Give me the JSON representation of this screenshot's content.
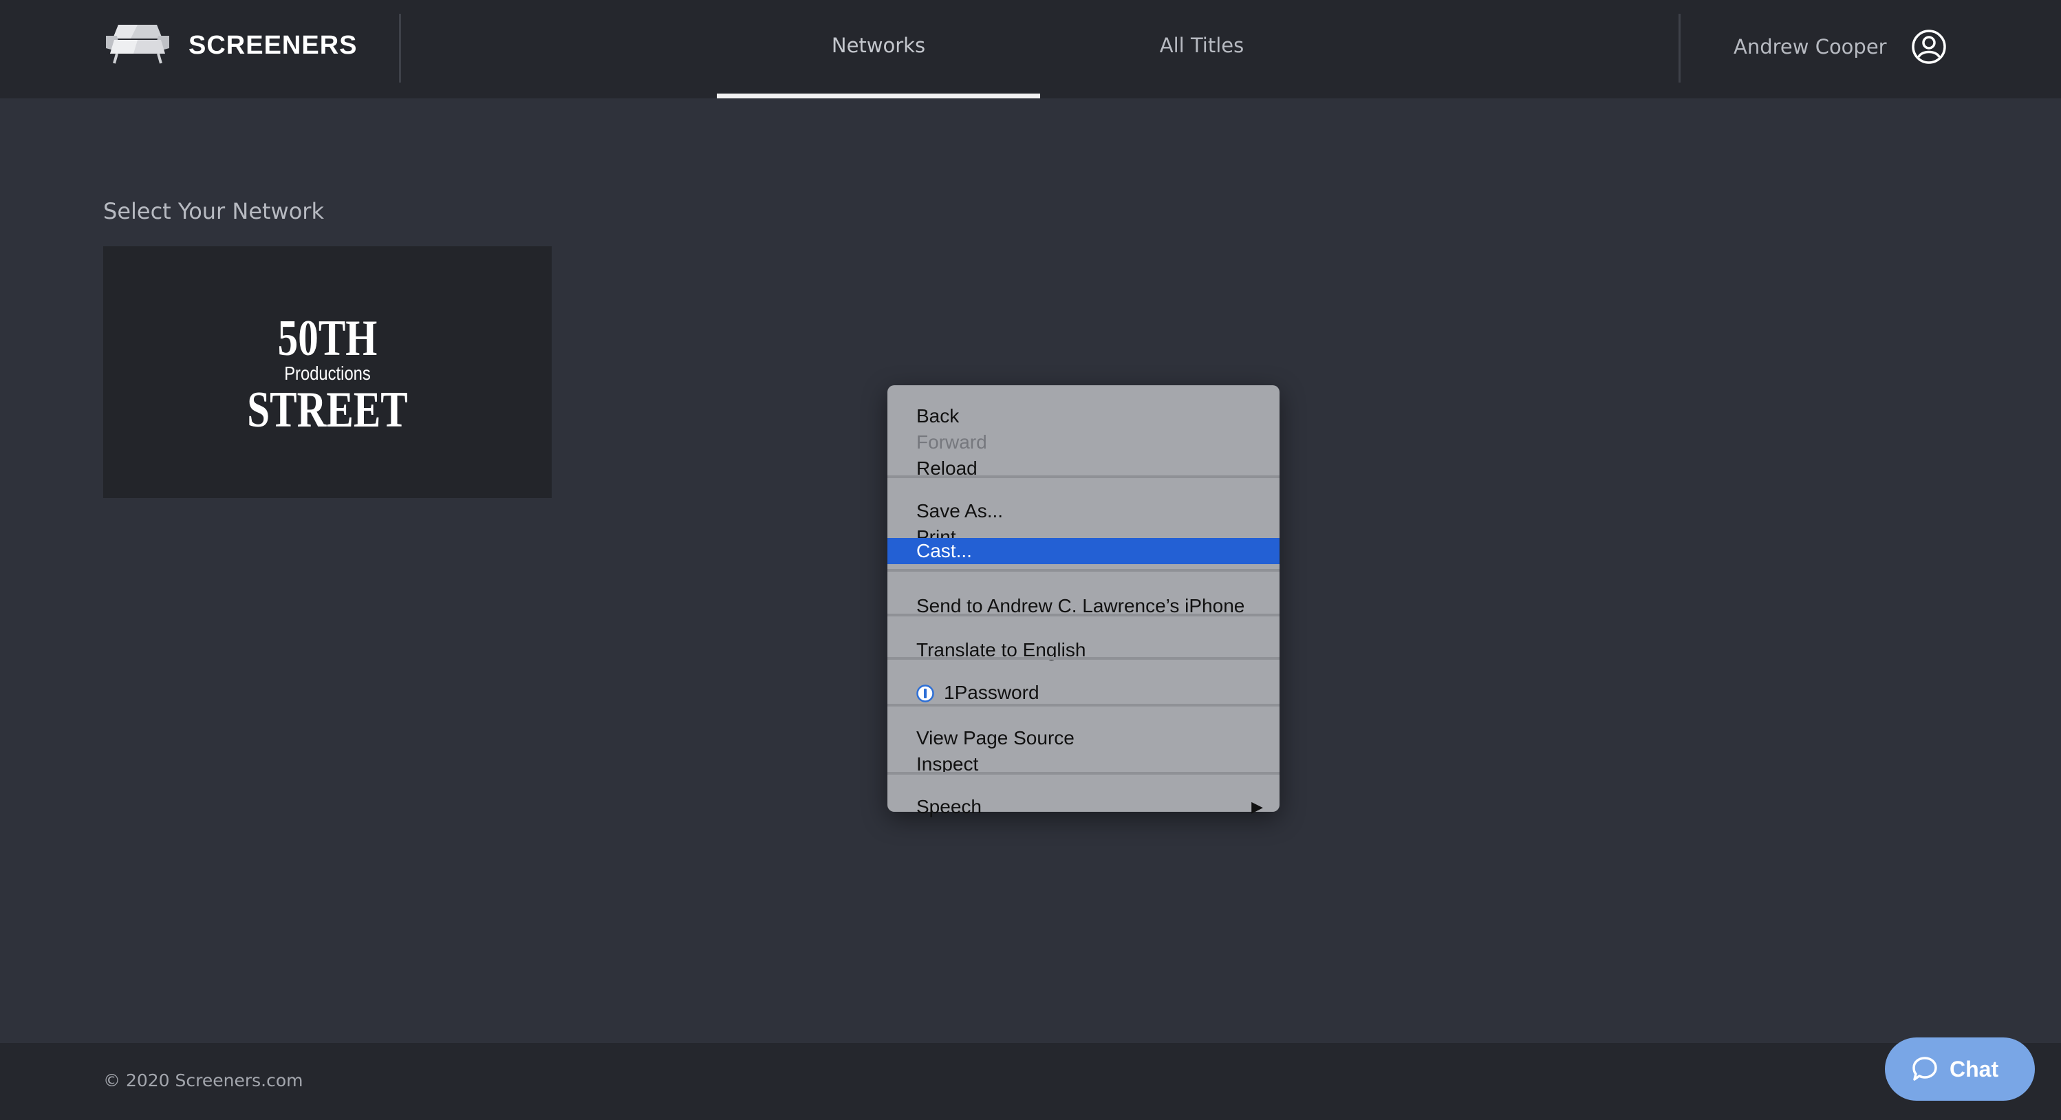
{
  "header": {
    "brand": "SCREENERS",
    "logo_icon": "couch-icon",
    "nav": [
      {
        "label": "Networks",
        "active": true
      },
      {
        "label": "All Titles",
        "active": false
      }
    ],
    "user_name": "Andrew Cooper",
    "user_icon": "user-circle-icon"
  },
  "main": {
    "section_title": "Select Your Network",
    "networks": [
      {
        "logo_line1": "50TH",
        "logo_line2": "Productions",
        "logo_line3": "STREET"
      }
    ]
  },
  "context_menu": {
    "items": [
      {
        "label": "Back",
        "enabled": true
      },
      {
        "label": "Forward",
        "enabled": false
      },
      {
        "label": "Reload",
        "enabled": true
      },
      {
        "label": "Save As...",
        "enabled": true
      },
      {
        "label": "Print...",
        "enabled": true
      },
      {
        "label": "Cast...",
        "enabled": true,
        "highlighted": true
      },
      {
        "label": "Send to Andrew C. Lawrence’s iPhone",
        "enabled": true
      },
      {
        "label": "Translate to English",
        "enabled": true
      },
      {
        "label": "1Password",
        "enabled": true,
        "icon": "1password-icon"
      },
      {
        "label": "View Page Source",
        "enabled": true
      },
      {
        "label": "Inspect",
        "enabled": true
      },
      {
        "label": "Speech",
        "enabled": true,
        "submenu": true
      }
    ],
    "submenu_glyph": "▶",
    "highlight_color": "#2360d4"
  },
  "footer": {
    "copyright": "© 2020 Screeners.com"
  },
  "chat": {
    "label": "Chat",
    "icon": "chat-bubble-icon",
    "color": "#79a6e6"
  }
}
